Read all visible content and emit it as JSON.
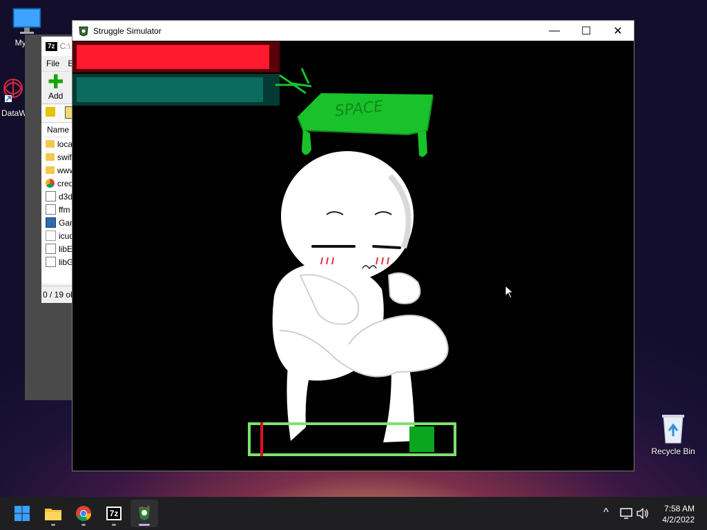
{
  "desktop": {
    "icons": [
      {
        "label": "My Co",
        "icon": "monitor-icon"
      },
      {
        "label": "DataW",
        "icon": "datawave-shortcut-icon"
      },
      {
        "label": "Recycle Bin",
        "icon": "recycle-bin-icon"
      }
    ]
  },
  "zip_window": {
    "title": "C:\\",
    "title_badge": "7z",
    "menu": [
      "File",
      "E"
    ],
    "add_label": "Add",
    "column_header": "Name",
    "files": [
      {
        "name": "loca",
        "icon": "folder-icon"
      },
      {
        "name": "swif",
        "icon": "folder-icon"
      },
      {
        "name": "www",
        "icon": "folder-icon"
      },
      {
        "name": "cred",
        "icon": "chrome-icon"
      },
      {
        "name": "d3d",
        "icon": "dll-icon"
      },
      {
        "name": "ffm",
        "icon": "dll-icon"
      },
      {
        "name": "Gan",
        "icon": "exe-icon"
      },
      {
        "name": "icud",
        "icon": "file-icon"
      },
      {
        "name": "libE",
        "icon": "dll-icon"
      },
      {
        "name": "libG",
        "icon": "dll-icon"
      }
    ],
    "status": "0 / 19 ob"
  },
  "game_window": {
    "title": "Struggle Simulator",
    "controls": {
      "minimize": "—",
      "maximize": "☐",
      "close": "✕"
    },
    "health_fill": 0.95,
    "stamina_fill": 0.93,
    "space_key_label": "SPACE",
    "timing_marker": 0.04,
    "target_zone": 0.8,
    "colors": {
      "health": "#ff1a2e",
      "stamina": "#0a6b5e",
      "space_key": "#19c22a",
      "timing_frame": "#7be36b"
    }
  },
  "taskbar": {
    "apps": [
      {
        "name": "start-icon"
      },
      {
        "name": "file-explorer-icon"
      },
      {
        "name": "chrome-icon"
      },
      {
        "name": "7zip-icon",
        "label": "7z"
      },
      {
        "name": "struggle-simulator-icon"
      }
    ],
    "tray_chevron": "^",
    "time": "7:58 AM",
    "date": "4/2/2022"
  }
}
